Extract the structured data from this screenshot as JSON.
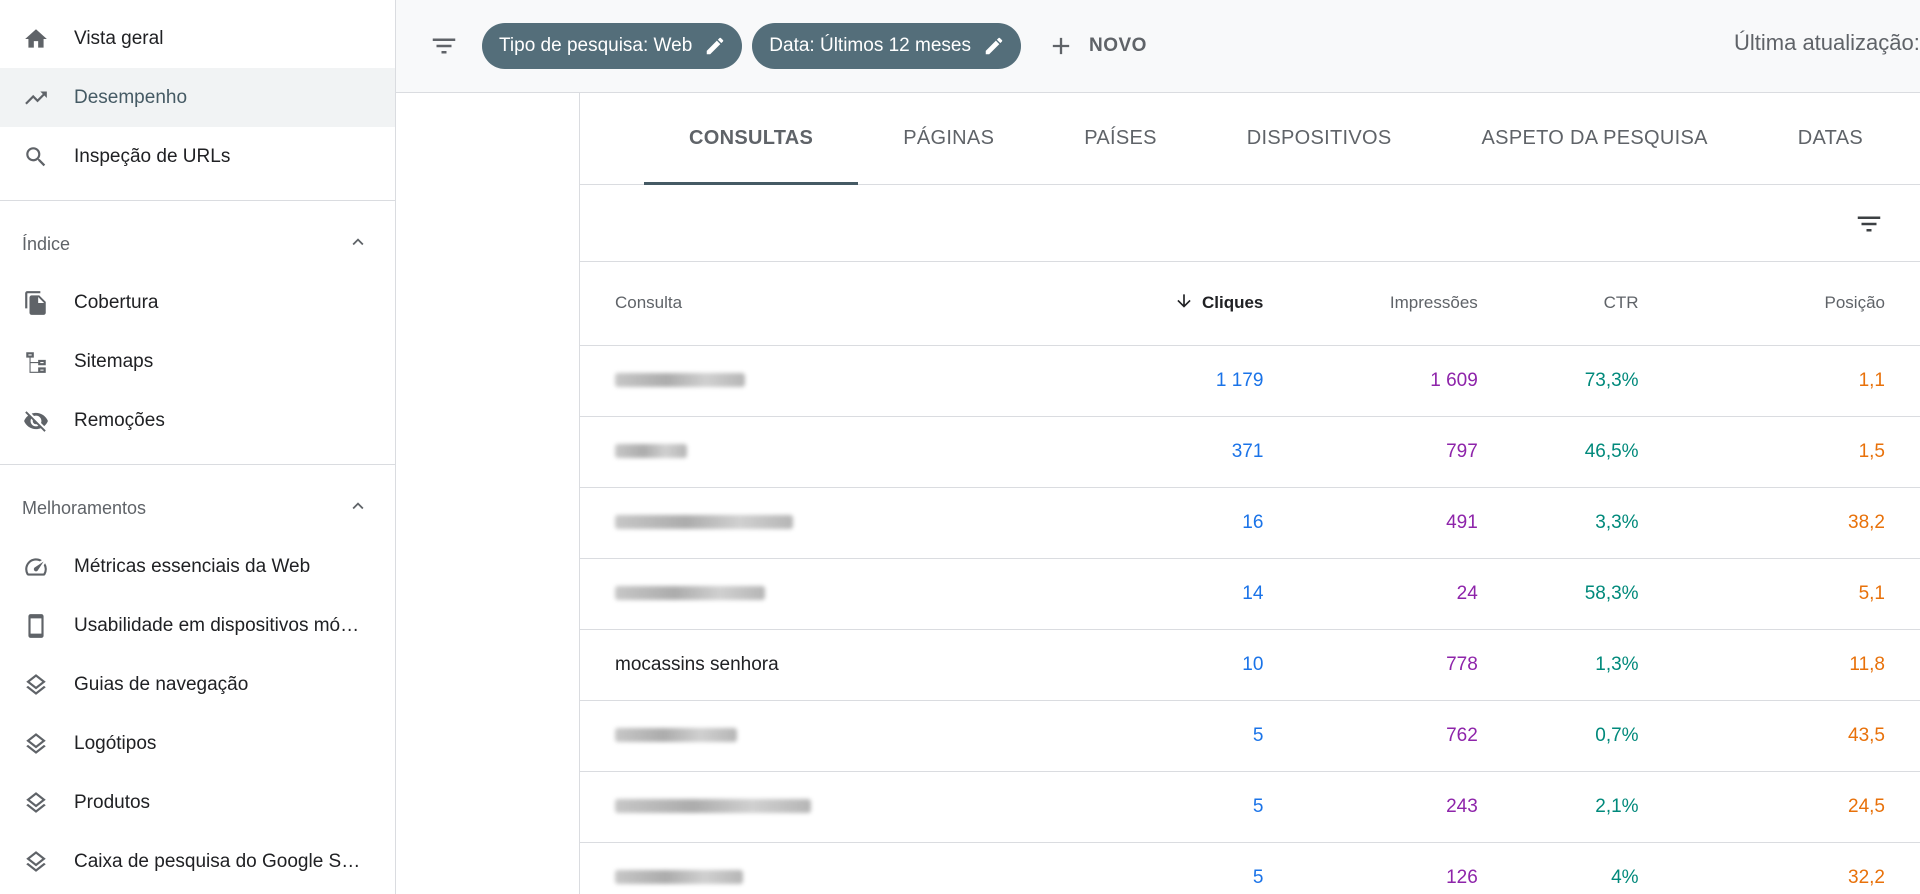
{
  "sidebar": {
    "items_top": [
      {
        "label": "Vista geral",
        "icon": "home-icon"
      },
      {
        "label": "Desempenho",
        "icon": "trending-up-icon",
        "active": true
      },
      {
        "label": "Inspeção de URLs",
        "icon": "search-icon"
      }
    ],
    "index_section": {
      "title": "Índice",
      "items": [
        {
          "label": "Cobertura",
          "icon": "copy-icon"
        },
        {
          "label": "Sitemaps",
          "icon": "sitemap-icon"
        },
        {
          "label": "Remoções",
          "icon": "eye-off-icon"
        }
      ]
    },
    "enhancements_section": {
      "title": "Melhoramentos",
      "items": [
        {
          "label": "Métricas essenciais da Web",
          "icon": "speed-gauge-icon"
        },
        {
          "label": "Usabilidade em dispositivos móveis",
          "icon": "smartphone-icon"
        },
        {
          "label": "Guias de navegação",
          "icon": "layers-icon"
        },
        {
          "label": "Logótipos",
          "icon": "layers-icon"
        },
        {
          "label": "Produtos",
          "icon": "layers-icon"
        },
        {
          "label": "Caixa de pesquisa do Google Sitelinks",
          "icon": "layers-icon"
        }
      ]
    }
  },
  "topbar": {
    "chip_search_type": "Tipo de pesquisa: Web",
    "chip_date": "Data: Últimos 12 meses",
    "new_label": "NOVO",
    "last_update": "Última atualização:"
  },
  "tabs": [
    "CONSULTAS",
    "PÁGINAS",
    "PAÍSES",
    "DISPOSITIVOS",
    "ASPETO DA PESQUISA",
    "DATAS"
  ],
  "active_tab": "CONSULTAS",
  "table": {
    "headers": {
      "query": "Consulta",
      "clicks": "Cliques",
      "impressions": "Impressões",
      "ctr": "CTR",
      "position": "Posição"
    },
    "sorted_by": "clicks",
    "rows": [
      {
        "query": "",
        "blurred": true,
        "clicks": "1 179",
        "impressions": "1 609",
        "ctr": "73,3%",
        "position": "1,1"
      },
      {
        "query": "",
        "blurred": true,
        "clicks": "371",
        "impressions": "797",
        "ctr": "46,5%",
        "position": "1,5"
      },
      {
        "query": "",
        "blurred": true,
        "clicks": "16",
        "impressions": "491",
        "ctr": "3,3%",
        "position": "38,2"
      },
      {
        "query": "",
        "blurred": true,
        "clicks": "14",
        "impressions": "24",
        "ctr": "58,3%",
        "position": "5,1"
      },
      {
        "query": "mocassins senhora",
        "blurred": false,
        "clicks": "10",
        "impressions": "778",
        "ctr": "1,3%",
        "position": "11,8"
      },
      {
        "query": "",
        "blurred": true,
        "clicks": "5",
        "impressions": "762",
        "ctr": "0,7%",
        "position": "43,5"
      },
      {
        "query": "",
        "blurred": true,
        "clicks": "5",
        "impressions": "243",
        "ctr": "2,1%",
        "position": "24,5"
      },
      {
        "query": "",
        "blurred": true,
        "clicks": "5",
        "impressions": "126",
        "ctr": "4%",
        "position": "32,2"
      }
    ]
  },
  "colors": {
    "clicks": "#1a73e8",
    "impressions": "#8e24aa",
    "ctr": "#00897b",
    "position": "#e8710a",
    "chip": "#546e7a"
  }
}
